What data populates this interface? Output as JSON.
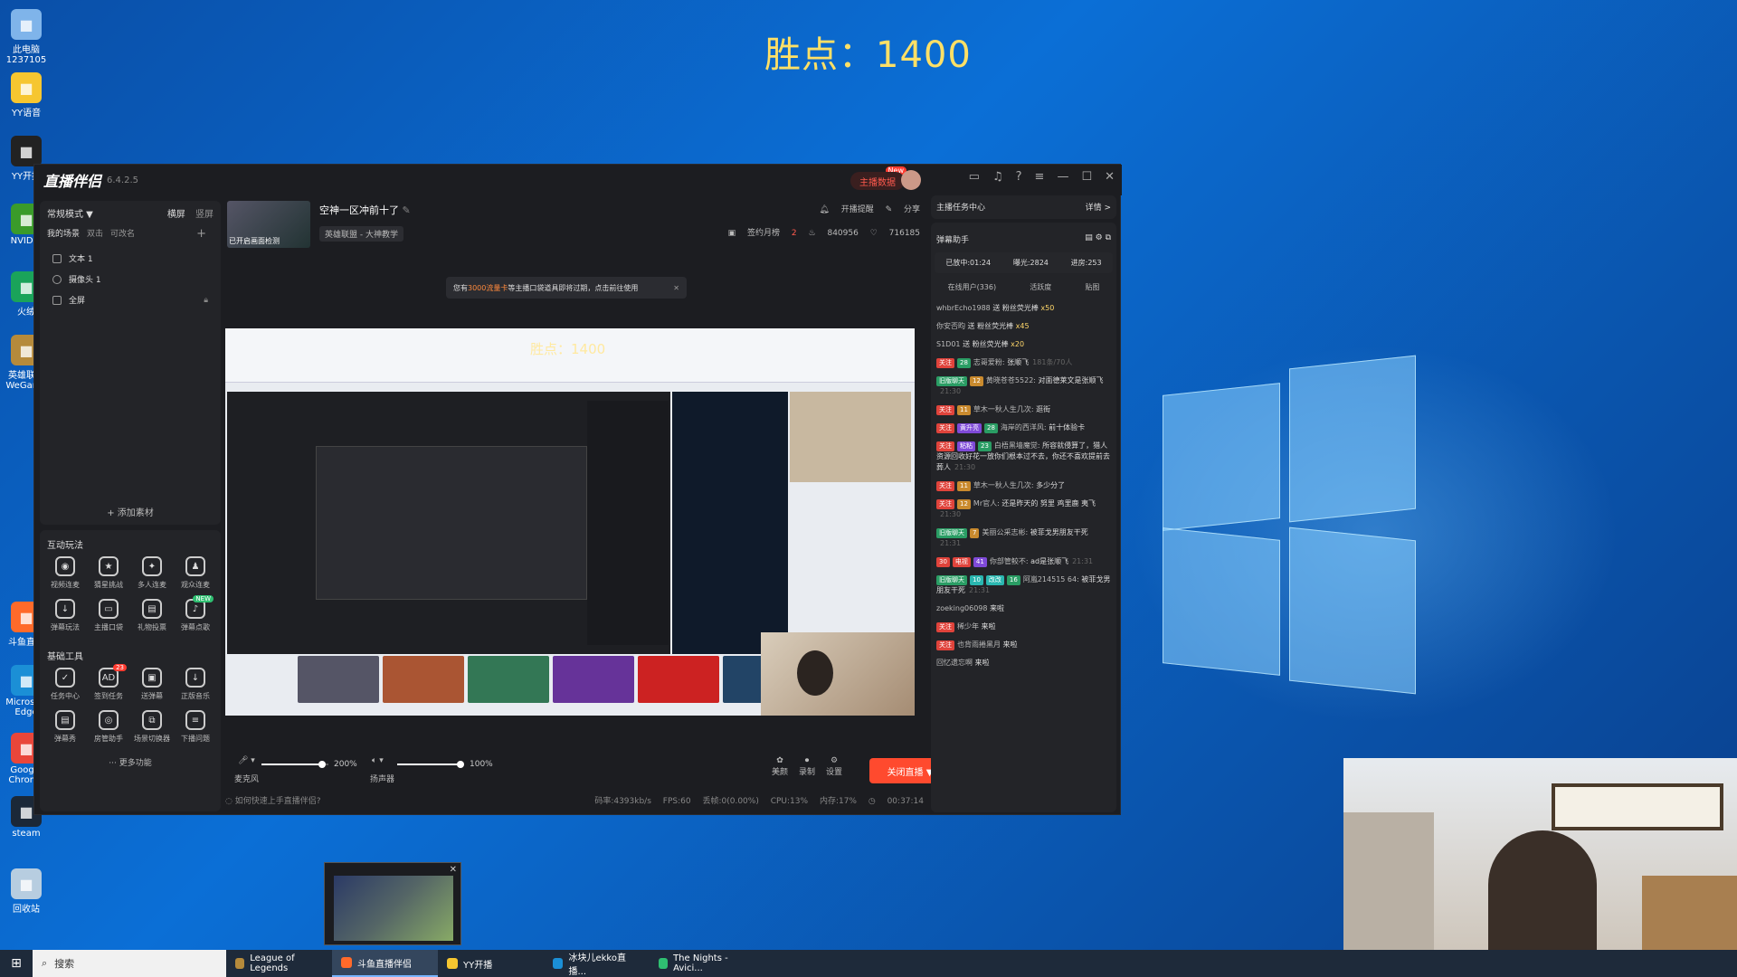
{
  "overlay": {
    "title": "胜点：1400"
  },
  "desktop_icons": [
    {
      "label": "此电脑",
      "sub": "1237105",
      "icon": "computer-icon",
      "color": "#7fb4ea"
    },
    {
      "label": "YY语音",
      "icon": "yy-icon",
      "color": "#f6c630"
    },
    {
      "label": "YY开播",
      "icon": "yy-live-icon",
      "color": "#222"
    },
    {
      "label": "NVIDIA",
      "icon": "nvidia-icon",
      "color": "#3a9b2a"
    },
    {
      "label": "火绒",
      "icon": "huorong-icon",
      "color": "#1aa35a"
    },
    {
      "label": "英雄联盟 WeGame",
      "icon": "wegame-icon",
      "color": "#b58a3b"
    },
    {
      "label": "斗鱼直播",
      "icon": "douyu-icon",
      "color": "#ff6a2a"
    },
    {
      "label": "Microsoft Edge",
      "icon": "edge-icon",
      "color": "#1b8fd6"
    },
    {
      "label": "Google Chrome",
      "icon": "chrome-icon",
      "color": "#e9463a"
    },
    {
      "label": "steam",
      "icon": "steam-icon",
      "color": "#1b2838"
    },
    {
      "label": "回收站",
      "icon": "recycle-bin-icon",
      "color": "#b7cde0"
    }
  ],
  "app": {
    "logo": "直播伴侣",
    "version": "6.4.2.5",
    "data_btn": "主播数据",
    "new_badge": "New"
  },
  "left": {
    "mode": "常规模式 ▼",
    "orient_h": "横屏",
    "orient_v": "竖屏",
    "scene_my": "我的场景",
    "scene_two": "双击",
    "scene_rename": "可改名",
    "scene_add": "+",
    "sources": [
      "文本 1",
      "摄像头 1",
      "全屏"
    ],
    "add_source": "+ 添加素材",
    "interactive_title": "互动玩法",
    "interactive": [
      {
        "label": "视频连麦",
        "icon": "mic-icon",
        "glyph": "◉"
      },
      {
        "label": "猜星挑战",
        "icon": "shield-icon",
        "glyph": "★"
      },
      {
        "label": "多人连麦",
        "icon": "multi-mic-icon",
        "glyph": "✦"
      },
      {
        "label": "观众连麦",
        "icon": "audience-icon",
        "glyph": "♟"
      },
      {
        "label": "弹幕玩法",
        "icon": "download-icon",
        "glyph": "↓"
      },
      {
        "label": "主播口袋",
        "icon": "pocket-icon",
        "glyph": "▭"
      },
      {
        "label": "礼物投票",
        "icon": "gift-vote-icon",
        "glyph": "▤"
      },
      {
        "label": "弹幕点歌",
        "icon": "song-icon",
        "glyph": "♪",
        "badge": "NEW"
      }
    ],
    "basic_title": "基础工具",
    "basic": [
      {
        "label": "任务中心",
        "icon": "task-icon",
        "glyph": "✓"
      },
      {
        "label": "签到任务",
        "icon": "ad-icon",
        "glyph": "AD",
        "badge": "23"
      },
      {
        "label": "送弹幕",
        "icon": "barrage-icon",
        "glyph": "▣"
      },
      {
        "label": "正版音乐",
        "icon": "music-download-icon",
        "glyph": "↓"
      },
      {
        "label": "弹幕秀",
        "icon": "barrage-show-icon",
        "glyph": "▤"
      },
      {
        "label": "房管助手",
        "icon": "admin-icon",
        "glyph": "◎"
      },
      {
        "label": "场景切换器",
        "icon": "scene-switch-icon",
        "glyph": "⧉"
      },
      {
        "label": "下播问题",
        "icon": "question-icon",
        "glyph": "≡"
      }
    ],
    "more": "··· 更多功能"
  },
  "room": {
    "thumb_text": "已开启画面检测",
    "title": "空神一区冲前十了",
    "category": "英雄联盟 - 大神教学",
    "reminder": "开播提醒",
    "share": "分享",
    "monthly_label": "签约月榜",
    "monthly_rank": "2",
    "fire": "840956",
    "likes": "716185"
  },
  "notice": {
    "pre": "您有",
    "highlight": "3000流量卡",
    "post": "等主播口袋道具即将过期，点击前往使用",
    "close": "✕"
  },
  "controls": {
    "mic_label": "麦克风",
    "mic_pct": "200%",
    "mic_level": 0.9,
    "spk_label": "扬声器",
    "spk_pct": "100%",
    "spk_level": 0.95,
    "beauty": "美颜",
    "record": "录制",
    "settings": "设置",
    "end_live": "关闭直播 ▼"
  },
  "status": {
    "help": "如何快速上手直播伴侣?",
    "bitrate": "码率:4393kb/s",
    "fps": "FPS:60",
    "drop": "丢帧:0(0.00%)",
    "cpu": "CPU:13%",
    "mem": "内存:17%",
    "time": "00:37:14"
  },
  "right": {
    "task_center": "主播任务中心",
    "detail": "详情 >",
    "assistant": "弹幕助手",
    "live_time": "已放中:01:24",
    "exposure": "曝光:2824",
    "enter": "进房:253",
    "online": "在线用户(336)",
    "active": "活跃度",
    "gift_tab": "贴图",
    "messages": [
      {
        "user": "whbrEcho1988",
        "text": "送 粉丝荧光棒",
        "gift": "x50"
      },
      {
        "user": "你安否昀",
        "text": "送 粉丝荧光棒",
        "gift": "x45"
      },
      {
        "user": "S1D01",
        "text": "送 粉丝荧光棒",
        "gift": "x20"
      },
      {
        "tags": [
          [
            "关注",
            "t-red"
          ],
          [
            "28",
            "t-green"
          ]
        ],
        "user": "志哥爱粉:",
        "text": "张顺飞",
        "time": "181条/70人"
      },
      {
        "tags": [
          [
            "旧版聊天",
            "t-green"
          ],
          [
            "12",
            "t-orange"
          ]
        ],
        "user": "黄晓苍苍5522:",
        "text": "对面德莱文是张顺飞",
        "time": "21:30"
      },
      {
        "tags": [
          [
            "关注",
            "t-red"
          ],
          [
            "11",
            "t-orange"
          ]
        ],
        "user": "草木一秋人生几次:",
        "text": "逛街",
        "time": ""
      },
      {
        "tags": [
          [
            "关注",
            "t-red"
          ],
          [
            "黄升亮",
            "t-purple"
          ],
          [
            "28",
            "t-green"
          ]
        ],
        "user": "海岸的西洋风:",
        "text": "前十体验卡",
        "time": ""
      },
      {
        "tags": [
          [
            "关注",
            "t-red"
          ],
          [
            "粘粘",
            "t-purple"
          ],
          [
            "23",
            "t-green"
          ]
        ],
        "user": "白梧黑墙魔觉:",
        "text": "所容就侵算了，猎人资源回收好花一放你们根本过不去，你还不喜欢提前去葬人",
        "time": "21:30"
      },
      {
        "tags": [
          [
            "关注",
            "t-red"
          ],
          [
            "11",
            "t-orange"
          ]
        ],
        "user": "草木一秋人生几次:",
        "text": "多少分了",
        "time": ""
      },
      {
        "tags": [
          [
            "关注",
            "t-red"
          ],
          [
            "12",
            "t-orange"
          ]
        ],
        "user": "Mr官人:",
        "text": "还是昨天的 努里 鸡里鹿 夷飞",
        "time": "21:30"
      },
      {
        "tags": [
          [
            "旧版聊天",
            "t-green"
          ],
          [
            "7",
            "t-orange"
          ]
        ],
        "user": "美丽公采志彬:",
        "text": "被菲戈男朋友干死",
        "time": "21:31"
      },
      {
        "tags": [
          [
            "30",
            "t-red"
          ],
          [
            "电视",
            "t-red"
          ],
          [
            "41",
            "t-purple"
          ]
        ],
        "user": "你部管鲛不:",
        "text": "ad是张顺飞",
        "time": "21:31"
      },
      {
        "tags": [
          [
            "旧版聊天",
            "t-green"
          ],
          [
            "10",
            "t-cyan"
          ],
          [
            "改改",
            "t-cyan"
          ],
          [
            "16",
            "t-green"
          ]
        ],
        "user": "阿嵐214515 64:",
        "text": "被菲戈男朋友干死",
        "time": "21:31"
      },
      {
        "user": "zoeking06098",
        "text": "来啦"
      },
      {
        "tags": [
          [
            "关注",
            "t-red"
          ]
        ],
        "user": "稀少年",
        "text": "来啦"
      },
      {
        "tags": [
          [
            "关注",
            "t-red"
          ]
        ],
        "user": "也背雨捲黑月",
        "text": "来啦"
      },
      {
        "user": "回忆遗忘啊",
        "text": "来啦"
      }
    ]
  },
  "taskbar": {
    "start": "⊞",
    "search": "搜索",
    "items": [
      {
        "label": "League of Legends",
        "icon": "lol-icon",
        "color": "#b58a3b"
      },
      {
        "label": "斗鱼直播伴侣",
        "icon": "douyu-task-icon",
        "color": "#ff6a2a",
        "active": true
      },
      {
        "label": "YY开播",
        "icon": "yy-task-icon",
        "color": "#f6c630"
      },
      {
        "label": "冰块儿ekko直播...",
        "icon": "edge-task-icon",
        "color": "#1b8fd6"
      },
      {
        "label": "The Nights - Avici...",
        "icon": "music-task-icon",
        "color": "#2fbf71"
      }
    ]
  }
}
